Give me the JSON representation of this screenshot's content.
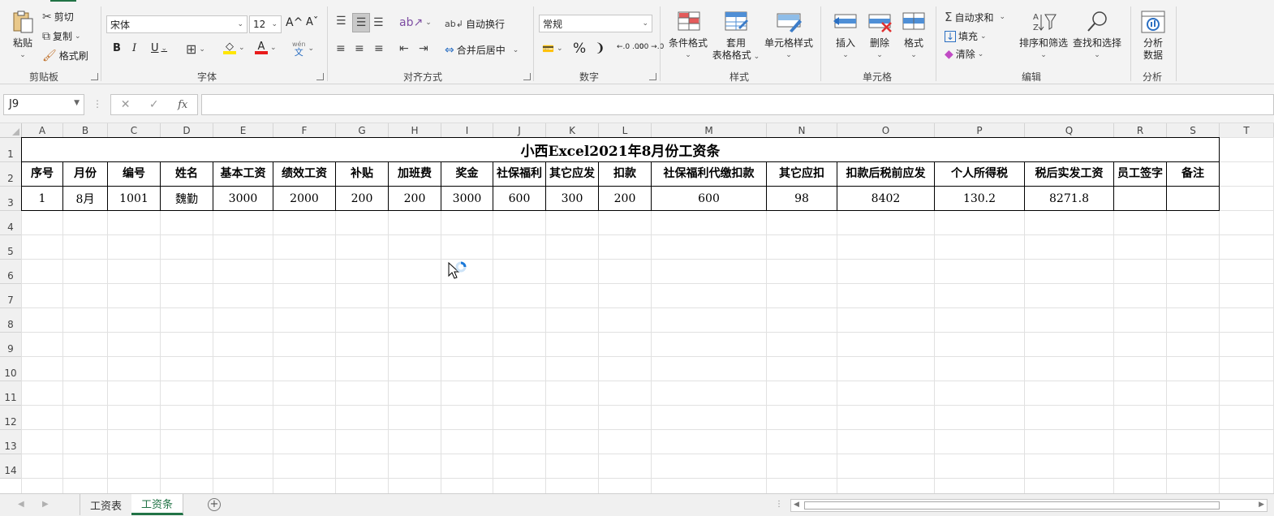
{
  "ribbon": {
    "clipboard": {
      "paste": "粘贴",
      "cut": "剪切",
      "copy": "复制",
      "format_painter": "格式刷",
      "group": "剪贴板"
    },
    "font": {
      "family": "宋体",
      "size": "12",
      "bold": "B",
      "italic": "I",
      "underline": "U",
      "group": "字体",
      "phonetic_top": "wén",
      "phonetic_bottom": "文",
      "grow_glyph": "A^",
      "shrink_glyph": "Aˇ",
      "font_color_glyph": "A"
    },
    "alignment": {
      "wrap_text": "自动换行",
      "merge_center": "合并后居中",
      "group": "对齐方式"
    },
    "number": {
      "format": "常规",
      "percent": "%",
      "comma": "❩",
      "inc_decimal": "←.0 .00",
      "dec_decimal": ".00 →.0",
      "group": "数字"
    },
    "styles": {
      "conditional": "条件格式",
      "as_table_line1": "套用",
      "as_table_line2": "表格格式",
      "cell_styles": "单元格样式",
      "group": "样式"
    },
    "cells": {
      "insert": "插入",
      "delete": "删除",
      "format": "格式",
      "group": "单元格"
    },
    "editing": {
      "autosum": "自动求和",
      "fill": "填充",
      "clear": "清除",
      "sort_filter": "排序和筛选",
      "find_select": "查找和选择",
      "group": "编辑"
    },
    "analysis": {
      "analyze_line1": "分析",
      "analyze_line2": "数据",
      "group": "分析"
    }
  },
  "formula_bar": {
    "name_box": "J9",
    "cancel": "✕",
    "enter": "✓",
    "fx": "fx",
    "formula": ""
  },
  "columns": [
    "A",
    "B",
    "C",
    "D",
    "E",
    "F",
    "G",
    "H",
    "I",
    "J",
    "K",
    "L",
    "M",
    "N",
    "O",
    "P",
    "Q",
    "R",
    "S",
    "T"
  ],
  "rows": [
    "1",
    "2",
    "3",
    "4",
    "5",
    "6",
    "7",
    "8",
    "9",
    "10",
    "11",
    "12",
    "13",
    "14"
  ],
  "sheet": {
    "title": "小西Excel2021年8月份工资条",
    "headers": [
      "序号",
      "月份",
      "编号",
      "姓名",
      "基本工资",
      "绩效工资",
      "补贴",
      "加班费",
      "奖金",
      "社保福利",
      "其它应发",
      "扣款",
      "社保福利代缴扣款",
      "其它应扣",
      "扣款后税前应发",
      "个人所得税",
      "税后实发工资",
      "员工签字",
      "备注"
    ],
    "row3": [
      "1",
      "8月",
      "1001",
      "魏勤",
      "3000",
      "2000",
      "200",
      "200",
      "3000",
      "600",
      "300",
      "200",
      "600",
      "98",
      "8402",
      "130.2",
      "8271.8",
      "",
      ""
    ]
  },
  "tabs": {
    "sheets": [
      {
        "label": "工资表",
        "active": false
      },
      {
        "label": "工资条",
        "active": true
      }
    ],
    "add": "+"
  },
  "colors": {
    "accent": "#217346",
    "selected_tab_text": "#217346"
  }
}
